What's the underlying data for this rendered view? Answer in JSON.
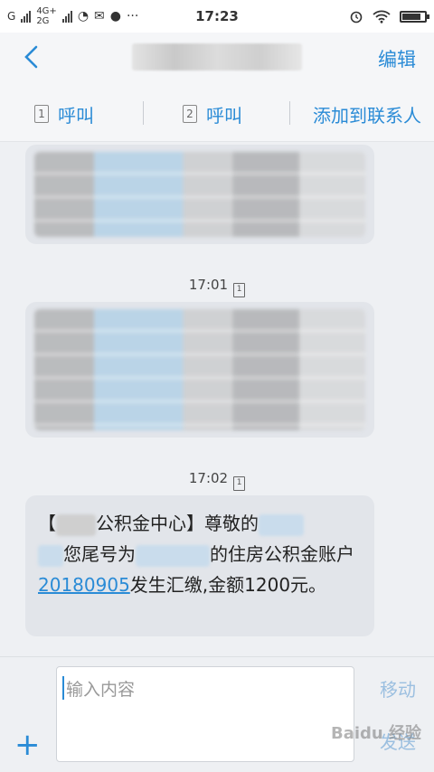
{
  "status_bar": {
    "network_1": "G",
    "network_2_top": "4G+",
    "network_2_bottom": "2G",
    "time": "17:23",
    "more": "···"
  },
  "header": {
    "edit_label": "编辑"
  },
  "actions": {
    "call1_sim": "1",
    "call1_label": "呼叫",
    "call2_sim": "2",
    "call2_label": "呼叫",
    "add_contact_label": "添加到联系人"
  },
  "messages": {
    "ts1": "17:01",
    "ts1_sim": "1",
    "ts2": "17:02",
    "ts2_sim": "1",
    "sms": {
      "part1": "【",
      "part2": "公积金中心】尊敬的",
      "part3": "您尾号为",
      "part4": "的住房公积金账户",
      "date_link": "20180905",
      "part5": "发生汇缴,金额1200元。"
    }
  },
  "input": {
    "placeholder": "输入内容",
    "sim_label": "移动",
    "send_label": "发送",
    "watermark": "Baidu 经验"
  },
  "colors": {
    "accent": "#2a8bd6",
    "bubble": "#e2e5ea"
  }
}
